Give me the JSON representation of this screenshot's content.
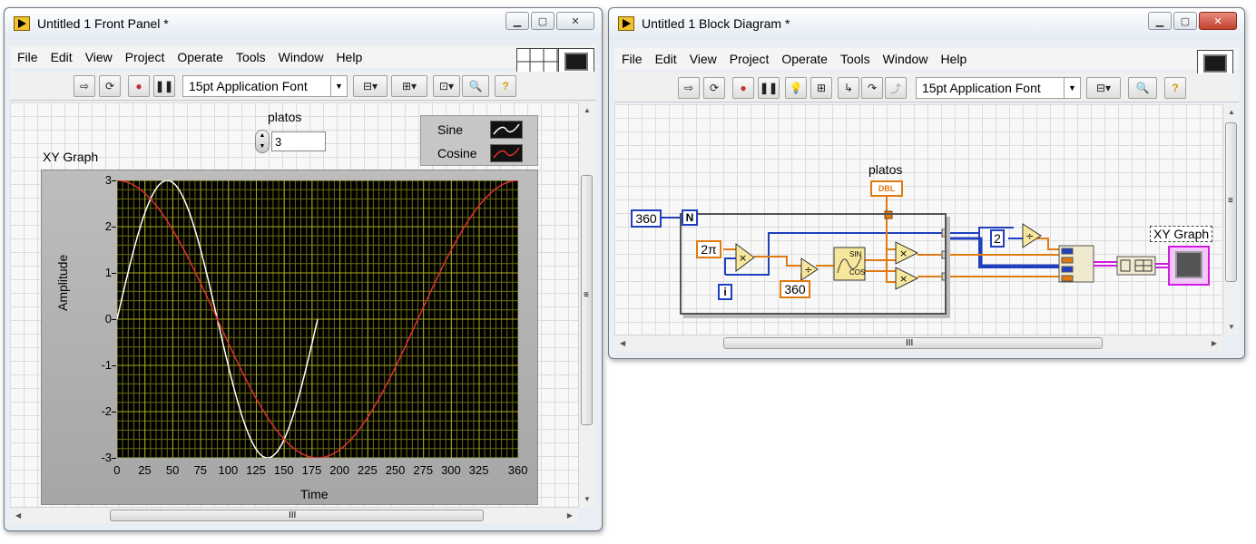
{
  "front_panel": {
    "title": "Untitled 1 Front Panel *",
    "menu": [
      "File",
      "Edit",
      "View",
      "Project",
      "Operate",
      "Tools",
      "Window",
      "Help"
    ],
    "font_ring": "15pt Application Font",
    "platos_label": "platos",
    "platos_value": "3",
    "graph_label": "XY Graph",
    "legend": [
      {
        "name": "Sine",
        "color": "#ffffff"
      },
      {
        "name": "Cosine",
        "color": "#e03030"
      }
    ],
    "xlabel": "Time",
    "ylabel": "Amplitude",
    "scroll_grip": "III",
    "vscroll_grip": "≡"
  },
  "block_diagram": {
    "title": "Untitled 1 Block Diagram *",
    "menu": [
      "File",
      "Edit",
      "View",
      "Project",
      "Operate",
      "Tools",
      "Window",
      "Help"
    ],
    "font_ring": "15pt Application Font",
    "const_360_n": "360",
    "loop_count": "N",
    "loop_index": "i",
    "const_2pi": "2π",
    "const_360_div": "360",
    "const_2": "2",
    "platos_label": "platos",
    "platos_type": "DBL",
    "sincos_top": "SIN",
    "sincos_bottom": "COS",
    "xy_graph_label": "XY Graph",
    "scroll_grip": "III",
    "vscroll_grip": "≡"
  },
  "window_number": "1",
  "chart_data": {
    "type": "line",
    "title": "XY Graph",
    "xlabel": "Time",
    "ylabel": "Amplitude",
    "xlim": [
      0,
      360
    ],
    "ylim": [
      -3,
      3
    ],
    "xticks": [
      0,
      25,
      50,
      75,
      100,
      125,
      150,
      175,
      200,
      225,
      250,
      275,
      300,
      325,
      360
    ],
    "yticks": [
      3,
      2,
      1,
      0,
      -1,
      -2,
      -3
    ],
    "grid": true,
    "series": [
      {
        "name": "Sine",
        "color": "#ffffff",
        "amplitude": 3,
        "period": 180,
        "function": "sin",
        "x_range": [
          0,
          180
        ]
      },
      {
        "name": "Cosine",
        "color": "#e03030",
        "amplitude": 3,
        "period": 360,
        "function": "cos",
        "x_range": [
          0,
          360
        ]
      }
    ]
  }
}
